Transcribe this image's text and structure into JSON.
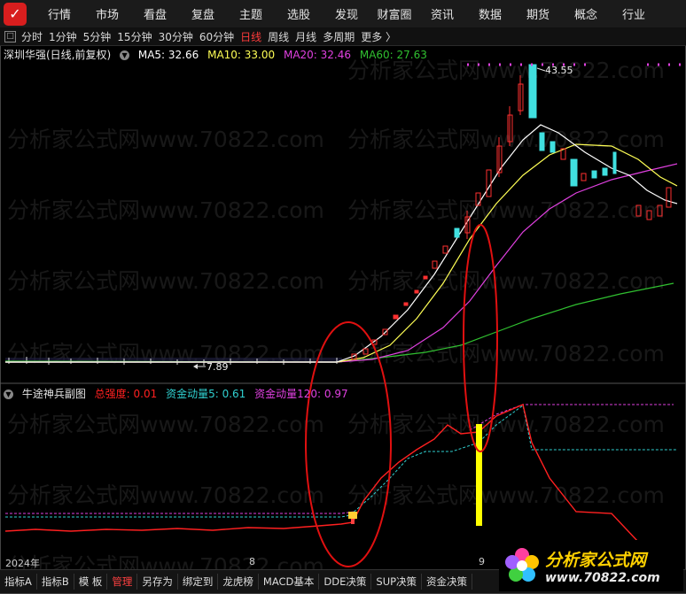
{
  "topnav": {
    "logo": "✓",
    "items": [
      "行情",
      "市场",
      "看盘",
      "复盘",
      "主题",
      "选股",
      "发现",
      "财富圈",
      "资讯",
      "数据",
      "期货",
      "概念",
      "行业"
    ]
  },
  "periodbar": {
    "icon": "□",
    "items": [
      "分时",
      "1分钟",
      "5分钟",
      "15分钟",
      "30分钟",
      "60分钟",
      "日线",
      "周线",
      "月线",
      "多周期",
      "更多 〉"
    ],
    "active": "日线"
  },
  "main_chart": {
    "title": "深圳华强(日线,前复权)",
    "ma": [
      {
        "label": "MA5: 32.66",
        "color": "#ffffff"
      },
      {
        "label": "MA10: 33.00",
        "color": "#ffff55"
      },
      {
        "label": "MA20: 32.46",
        "color": "#e040e0"
      },
      {
        "label": "MA60: 27.63",
        "color": "#30c030"
      }
    ],
    "high_label": "43.55",
    "low_label": "7.89"
  },
  "sub_chart": {
    "title": "牛途神兵副图",
    "indicators": [
      {
        "label": "总强度: 0.01",
        "color": "#ff2020"
      },
      {
        "label": "资金动量5: 0.61",
        "color": "#30d0d0"
      },
      {
        "label": "资金动量120: 0.97",
        "color": "#e040e0"
      }
    ]
  },
  "date_axis": [
    "2024年",
    "8",
    "9"
  ],
  "tabs": [
    "指标A",
    "指标B",
    "模 板",
    "管理",
    "另存为",
    "绑定到",
    "龙虎榜",
    "MACD基本",
    "DDE决策",
    "SUP决策",
    "资金决策"
  ],
  "active_tab": "管理",
  "watermark": "分析家公式网www.70822.com",
  "brand": {
    "name": "分析家公式网",
    "url": "www.70822.com"
  },
  "colors": {
    "up": "#ff3030",
    "down": "#40e0e0",
    "ma5": "#ffffff",
    "ma10": "#ffff55",
    "ma20": "#e040e0",
    "ma60": "#30c030",
    "highlight": "#ffff00",
    "ellipse": "#e01010"
  },
  "chart_data": {
    "type": "line",
    "series": [
      {
        "name": "MA5",
        "value": 32.66
      },
      {
        "name": "MA10",
        "value": 33.0
      },
      {
        "name": "MA20",
        "value": 32.46
      },
      {
        "name": "MA60",
        "value": 27.63
      }
    ]
  }
}
